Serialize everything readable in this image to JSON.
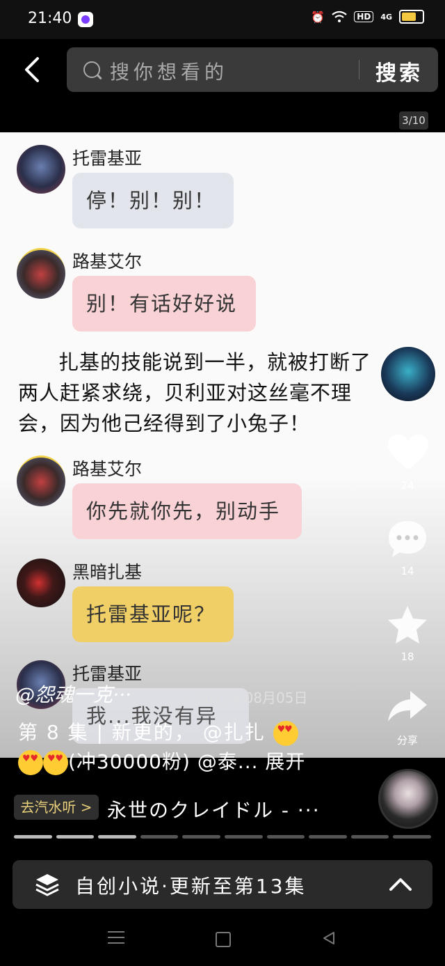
{
  "status_bar": {
    "time": "21:40",
    "network": "4G",
    "hd": "HD"
  },
  "search": {
    "placeholder": "搜你想看的",
    "button": "搜索"
  },
  "page_indicator": "3/10",
  "chat": [
    {
      "name": "托雷基亚",
      "message": "停！别！别！",
      "color": "gray",
      "avatar": "torrekia-avatar"
    },
    {
      "name": "路基艾尔",
      "message": "别！有话好好说",
      "color": "pink",
      "avatar": "lugiel-avatar"
    },
    {
      "name": "路基艾尔",
      "message": "你先就你先，别动手",
      "color": "pink",
      "avatar": "lugiel-avatar"
    },
    {
      "name": "黑暗扎基",
      "message": "托雷基亚呢？",
      "color": "yellow",
      "avatar": "dark-zagi-avatar"
    },
    {
      "name": "托雷基亚",
      "message": "我...我没有异议",
      "color": "gray",
      "avatar": "torrekia-avatar"
    }
  ],
  "narration": "扎基的技能说到一半，就被打断了两人赶紧求绕，贝利亚对这丝毫不理会，因为他己经得到了小兔子！",
  "rail": {
    "likes": "24",
    "comments": "14",
    "favorites": "18",
    "share": "分享"
  },
  "caption": {
    "author": "@怨魂一克···",
    "date": "· 2022年08月05日",
    "line1": "第 8 集 | 新更的， @扎扎",
    "line2": "(冲30000粉) @泰... 展开"
  },
  "music": {
    "tag": "去汽水听 >",
    "title": "永世のクレイドル - ···"
  },
  "progress": {
    "total": 10,
    "current": 3
  },
  "collection": {
    "label": "自创小说·更新至第13集"
  },
  "colors": {
    "bubble_gray": "#e3e5ec",
    "bubble_pink": "#f9d2d6",
    "bubble_yellow": "#f0cf67",
    "music_tag": "#e8d07a"
  }
}
